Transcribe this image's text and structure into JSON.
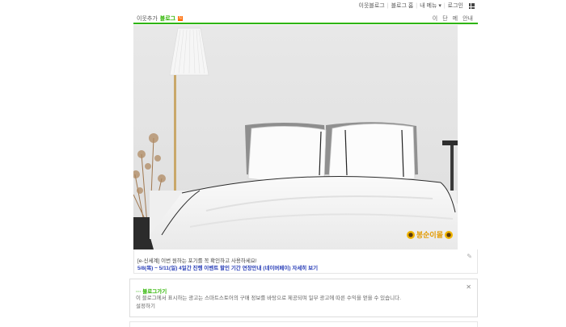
{
  "topbar": {
    "links": [
      "이웃블로그",
      "블로그 홈",
      "내 메뉴 ▾",
      "로그인"
    ],
    "apps_icon": "grid-icon"
  },
  "nav": {
    "home_label": "이웃추가",
    "blog_label": "블로그",
    "badge": "N",
    "right_links": [
      "이",
      "단",
      "메",
      "안내"
    ]
  },
  "photo": {
    "watermark": "봉순이몰"
  },
  "post": {
    "line1": "[e-신세계] 이번 원하는 포기를 꼭 확인하고 사용하세요!",
    "line2": "5/8(목) ~ 5/11(일) 4일간 진행 이벤트 할인 기간 연장안내 (네이버페이) 자세히 보기"
  },
  "notice": {
    "title": "··· 블로그가기",
    "body": "이 블로그에서 표시하는 광고는 스마트스토어의 구매 정보를 바탕으로 제공되며 일부 광고에 따른 수익을 얻을 수 있습니다.",
    "body2": "설정하기",
    "close_icon": "close-icon"
  },
  "colors": {
    "brand_green": "#2db400",
    "link_blue": "#2a3fb8"
  }
}
